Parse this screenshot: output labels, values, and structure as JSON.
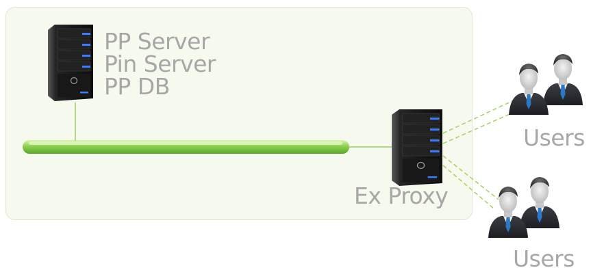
{
  "main_server": {
    "labels": [
      "PP Server",
      "Pin Server",
      "PP DB"
    ]
  },
  "proxy": {
    "label": "Ex Proxy"
  },
  "user_groups": {
    "top_label": "Users",
    "bottom_label": "Users"
  },
  "colors": {
    "panel_fill": "#f6f9ee",
    "network_bus": "#8fd14f",
    "connector": "#9ccc65",
    "label_text": "#a7a7a7",
    "server_led": "#3d7dff"
  },
  "icons": {
    "server": "server-tower-icon",
    "users": "user-group-icon"
  }
}
